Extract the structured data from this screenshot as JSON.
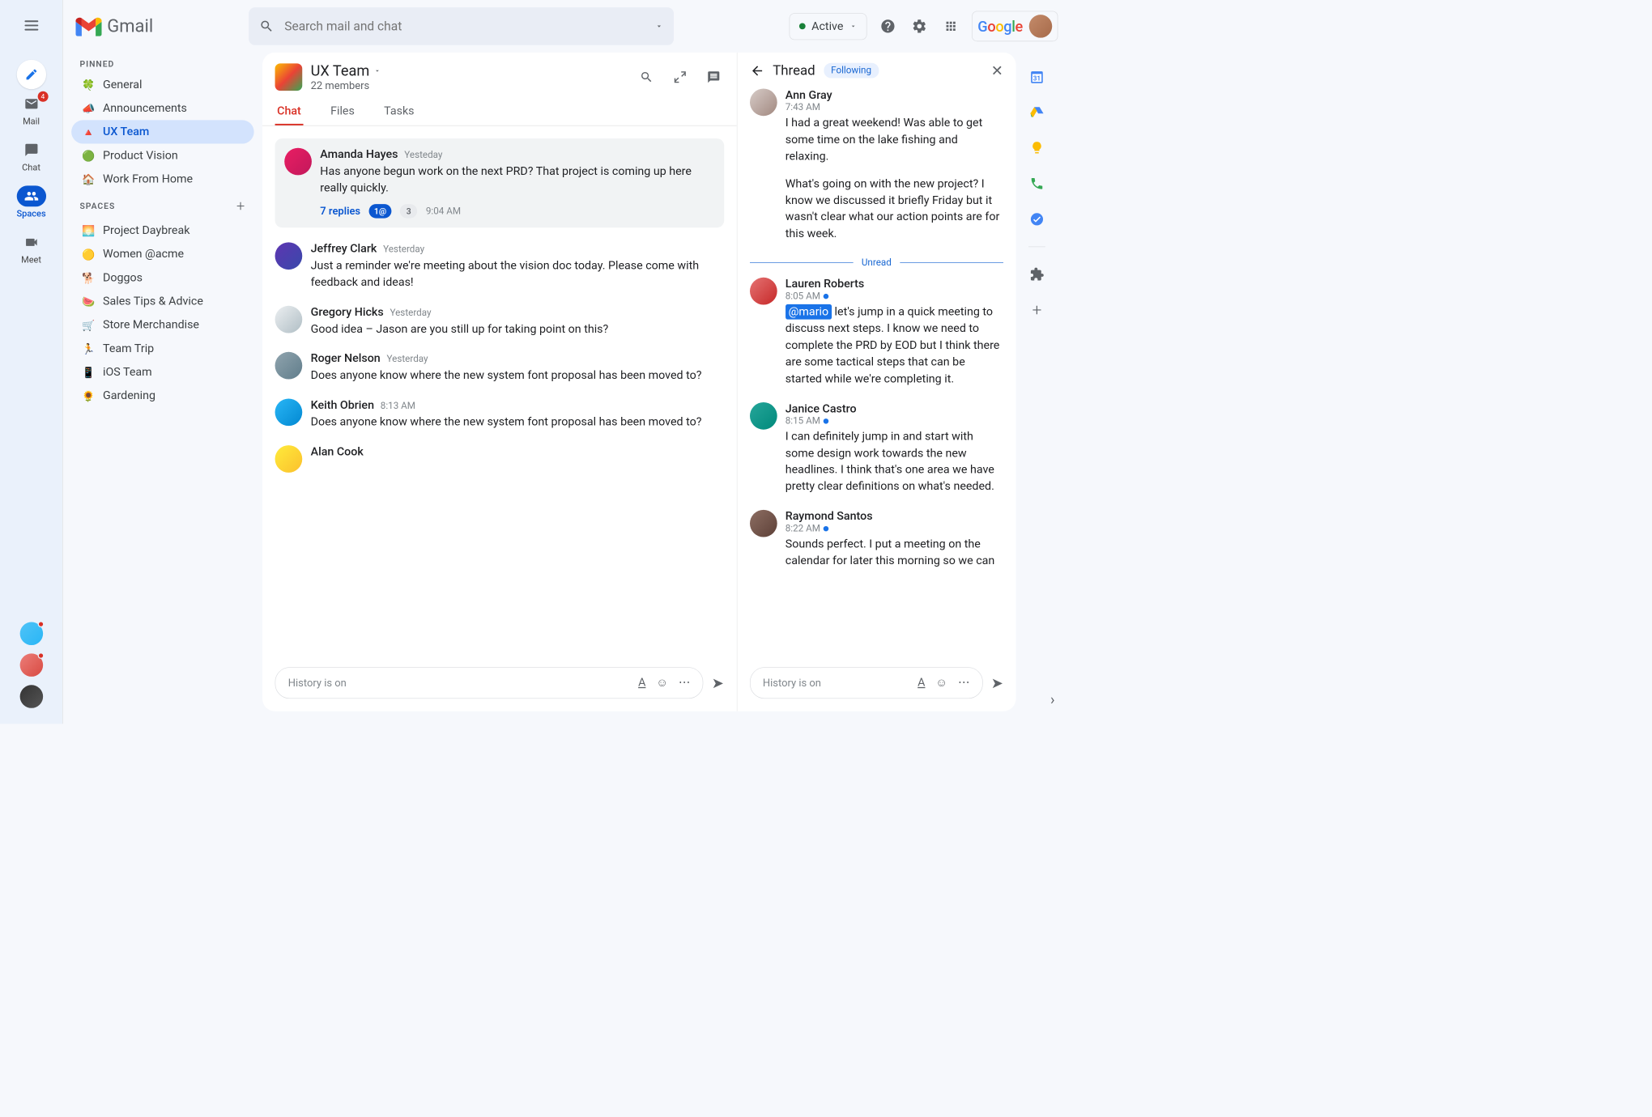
{
  "header": {
    "product": "Gmail",
    "search_placeholder": "Search mail and chat",
    "status": "Active",
    "google": "Google"
  },
  "rail": {
    "mail": {
      "label": "Mail",
      "badge": "4"
    },
    "chat": {
      "label": "Chat"
    },
    "spaces": {
      "label": "Spaces"
    },
    "meet": {
      "label": "Meet"
    }
  },
  "sidebar": {
    "pinned_label": "PINNED",
    "spaces_label": "SPACES",
    "pinned": [
      {
        "icon": "🍀",
        "label": "General"
      },
      {
        "icon": "📣",
        "label": "Announcements"
      },
      {
        "icon": "🔺",
        "label": "UX Team"
      },
      {
        "icon": "🟢",
        "label": "Product Vision"
      },
      {
        "icon": "🏠",
        "label": "Work From Home"
      }
    ],
    "spaces": [
      {
        "icon": "🌅",
        "label": "Project Daybreak"
      },
      {
        "icon": "🟡",
        "label": "Women @acme"
      },
      {
        "icon": "🐕",
        "label": "Doggos"
      },
      {
        "icon": "🍉",
        "label": "Sales Tips & Advice"
      },
      {
        "icon": "🛒",
        "label": "Store Merchandise"
      },
      {
        "icon": "🏃",
        "label": "Team Trip"
      },
      {
        "icon": "📱",
        "label": "iOS Team"
      },
      {
        "icon": "🌻",
        "label": "Gardening"
      }
    ]
  },
  "chat": {
    "space_name": "UX Team",
    "member_count": "22 members",
    "tabs": {
      "chat": "Chat",
      "files": "Files",
      "tasks": "Tasks"
    },
    "reply_card": {
      "author": "Amanda Hayes",
      "time": "Yesteday",
      "text": "Has anyone begun work on the next PRD? That project is coming up here really quickly.",
      "replies": "7 replies",
      "mention_pill": "1@",
      "count_pill": "3",
      "last_time": "9:04 AM"
    },
    "messages": [
      {
        "author": "Jeffrey Clark",
        "time": "Yesterday",
        "text": "Just a reminder we're meeting about the vision doc today. Please come with feedback and ideas!",
        "av": "av2"
      },
      {
        "author": "Gregory Hicks",
        "time": "Yesterday",
        "text": "Good idea – Jason are you still up for taking point on this?",
        "av": "av3"
      },
      {
        "author": "Roger Nelson",
        "time": "Yesterday",
        "text": "Does anyone know where the new system font proposal has been moved to?",
        "av": "av4"
      },
      {
        "author": "Keith Obrien",
        "time": "8:13 AM",
        "text": "Does anyone know where the new system font proposal has been moved to?",
        "av": "av5"
      },
      {
        "author": "Alan Cook",
        "time": "",
        "text": "",
        "av": "av6"
      }
    ],
    "compose_placeholder": "History is on"
  },
  "thread": {
    "title": "Thread",
    "following": "Following",
    "unread_label": "Unread",
    "messages": [
      {
        "author": "Ann Gray",
        "time": "7:43 AM",
        "text": "I had a great weekend! Was able to get some time on the lake fishing and relaxing.",
        "text2": "What's going on with the new project? I know we discussed it briefly Friday but it wasn't clear what our action points are for this week.",
        "av": "av7",
        "unread": false
      },
      {
        "author": "Lauren Roberts",
        "time": "8:05 AM",
        "mention": "@mario",
        "text": " let's jump in a quick meeting to discuss next steps. I know we need to complete the PRD by EOD but I think there are some tactical steps that can be started while we're completing it.",
        "av": "av8",
        "unread": true
      },
      {
        "author": "Janice Castro",
        "time": "8:15 AM",
        "text": "I can definitely jump in and start with some design work towards the new headlines. I think that's one area we have pretty clear definitions on what's needed.",
        "av": "av9",
        "unread": true
      },
      {
        "author": "Raymond Santos",
        "time": "8:22 AM",
        "text": "Sounds perfect. I put a meeting on the calendar for later this morning so we can",
        "av": "av10",
        "unread": true
      }
    ],
    "compose_placeholder": "History is on"
  }
}
